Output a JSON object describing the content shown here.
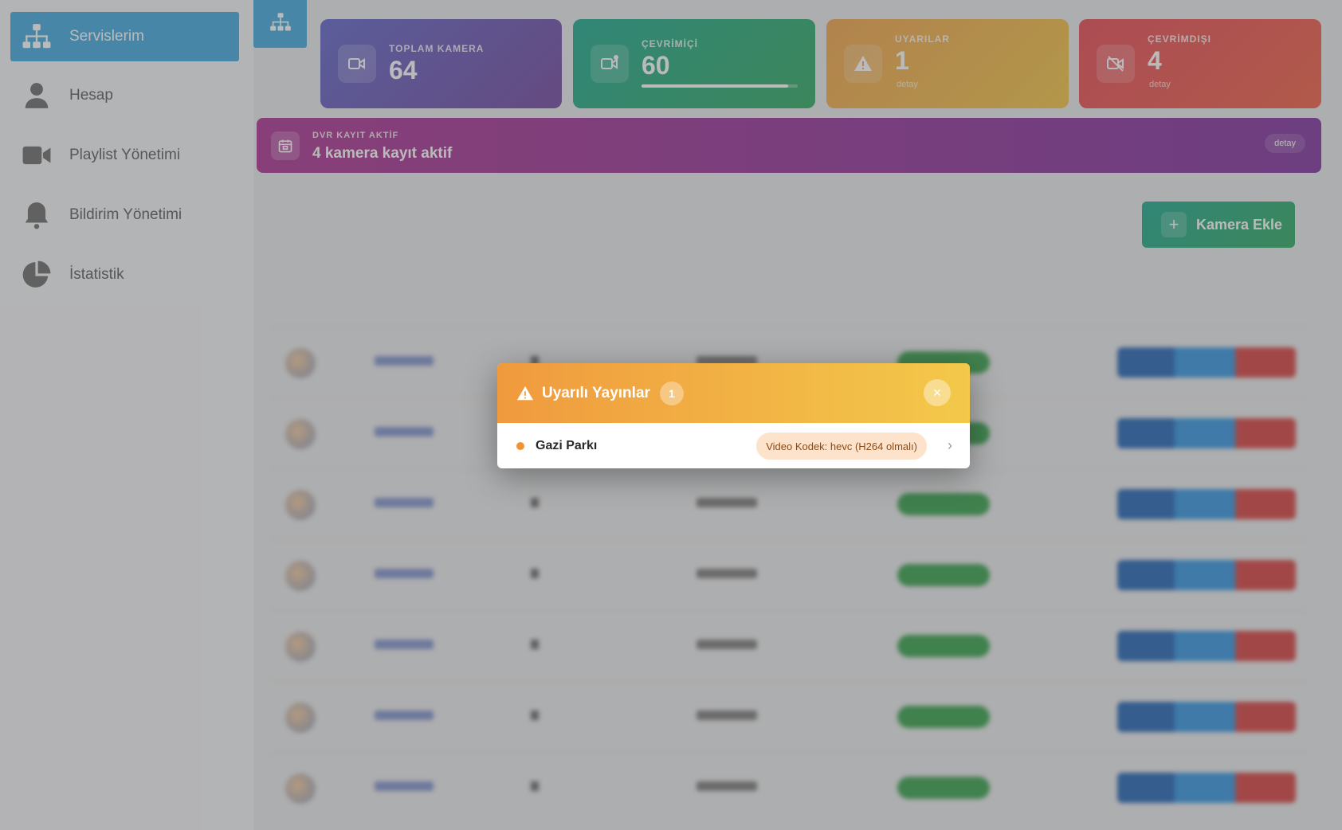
{
  "sidebar": {
    "items": [
      {
        "label": "Servislerim",
        "icon": "sitemap-icon"
      },
      {
        "label": "Hesap",
        "icon": "user-icon"
      },
      {
        "label": "Playlist Yönetimi",
        "icon": "video-camera-icon"
      },
      {
        "label": "Bildirim Yönetimi",
        "icon": "bell-icon"
      },
      {
        "label": "İstatistik",
        "icon": "pie-chart-icon"
      }
    ]
  },
  "stats": {
    "total": {
      "label": "TOPLAM KAMERA",
      "value": "64"
    },
    "online": {
      "label": "ÇEVRİMİÇİ",
      "value": "60",
      "progress": 0.94
    },
    "warnings": {
      "label": "UYARILAR",
      "value": "1",
      "detail": "detay"
    },
    "offline": {
      "label": "ÇEVRİMDIŞI",
      "value": "4",
      "detail": "detay"
    }
  },
  "dvr": {
    "label": "DVR KAYIT AKTİF",
    "value": "4 kamera kayıt aktif",
    "detail": "detay"
  },
  "add_camera": {
    "label": "Kamera Ekle"
  },
  "modal": {
    "title": "Uyarılı Yayınlar",
    "count": "1",
    "close": "×",
    "items": [
      {
        "name": "Gazi Parkı",
        "issue": "Video Kodek: hevc (H264 olmalı)"
      }
    ]
  },
  "colors": {
    "primary": "#3aa5dc",
    "success": "#27a65c",
    "warning": "#f3c33f",
    "danger": "#e7424f",
    "dvr": "#a92b8f"
  }
}
